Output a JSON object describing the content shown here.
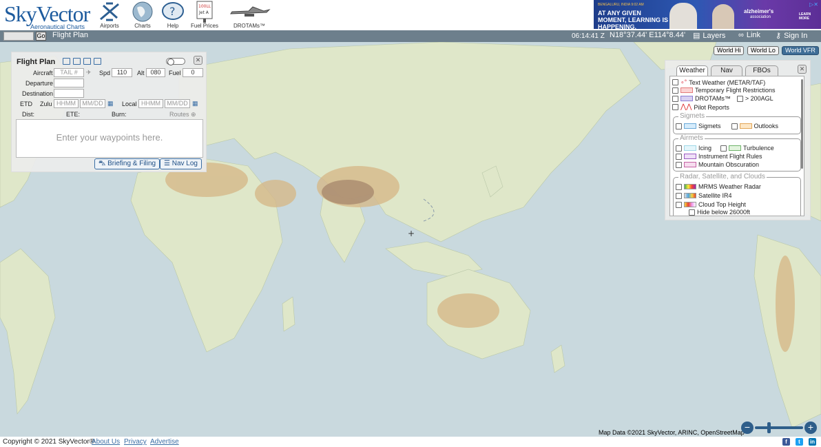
{
  "header": {
    "logo_text": "SkyVector",
    "logo_subtitle": "Aeronautical Charts",
    "nav": [
      {
        "label": "Airports",
        "icon": "airplane-icon"
      },
      {
        "label": "Charts",
        "icon": "globe-icon"
      },
      {
        "label": "Help",
        "icon": "help-icon"
      },
      {
        "label": "Fuel Prices",
        "icon": "fuel-price-sign-icon",
        "sign_text": "100LL Jet A"
      },
      {
        "label": "DROTAMs™",
        "icon": "drone-icon"
      }
    ],
    "ad": {
      "kicker": "BENGALURU, INDIA 9:02 AM",
      "headline": "AT ANY GIVEN MOMENT, LEARNING IS HAPPENING.",
      "brand": "alzheimer's",
      "brand_sub": "association",
      "cta": "LEARN MORE"
    }
  },
  "toolbar": {
    "go_label": "Go",
    "flight_plan_label": "Flight Plan",
    "time": "06:14:41 Z",
    "coordinates": "N18°37.44' E114°8.44'",
    "layers_label": "Layers",
    "link_label": "Link",
    "sign_in_label": "Sign In"
  },
  "flight_plan": {
    "title": "Flight Plan",
    "aircraft_label": "Aircraft",
    "aircraft_placeholder": "TAIL #",
    "spd_label": "Spd",
    "spd_value": "110",
    "alt_label": "Alt",
    "alt_value": "080",
    "fuel_label": "Fuel",
    "fuel_value": "0",
    "departure_label": "Departure",
    "destination_label": "Destination",
    "etd_label": "ETD",
    "zulu_label": "Zulu",
    "time_placeholder": "HHMM",
    "date_placeholder": "MM/DD",
    "local_label": "Local",
    "dist_label": "Dist:",
    "ete_label": "ETE:",
    "burn_label": "Burn:",
    "routes_label": "Routes",
    "waypoints_placeholder": "Enter your waypoints here.",
    "briefing_label": "Briefing & Filing",
    "navlog_label": "Nav Log"
  },
  "views": [
    "World Hi",
    "World Lo",
    "World VFR"
  ],
  "active_view": "World VFR",
  "layers": {
    "tabs": [
      "Weather",
      "Nav",
      "FBOs"
    ],
    "active_tab": "Weather",
    "items": {
      "text_weather": "Text Weather (METAR/TAF)",
      "tfr": "Temporary Flight Restrictions",
      "drotams": "DROTAMs™",
      "agl": "> 200AGL",
      "pireps": "Pilot Reports"
    },
    "sigmets_group": "Sigmets",
    "sigmets": "Sigmets",
    "outlooks": "Outlooks",
    "airmets_group": "Airmets",
    "icing": "Icing",
    "turbulence": "Turbulence",
    "ifr": "Instrument Flight Rules",
    "mountain": "Mountain Obscuration",
    "radar_group": "Radar, Satellite, and Clouds",
    "radar": "MRMS Weather Radar",
    "satellite": "Satellite IR4",
    "cloud_top": "Cloud Top Height",
    "hide_below": "Hide below 26000ft"
  },
  "colors": {
    "ocean": "#c9d9de",
    "land": "#dfe7c9",
    "toolbar": "#6d7f8c",
    "accent": "#3e6d96",
    "brand": "#1d5b9e"
  },
  "map": {
    "attribution": "Map Data ©2021 SkyVector, ARINC, OpenStreetMap"
  },
  "footer": {
    "copyright": "Copyright © 2021 SkyVector®",
    "links": [
      "About Us",
      "Privacy",
      "Advertise"
    ]
  }
}
